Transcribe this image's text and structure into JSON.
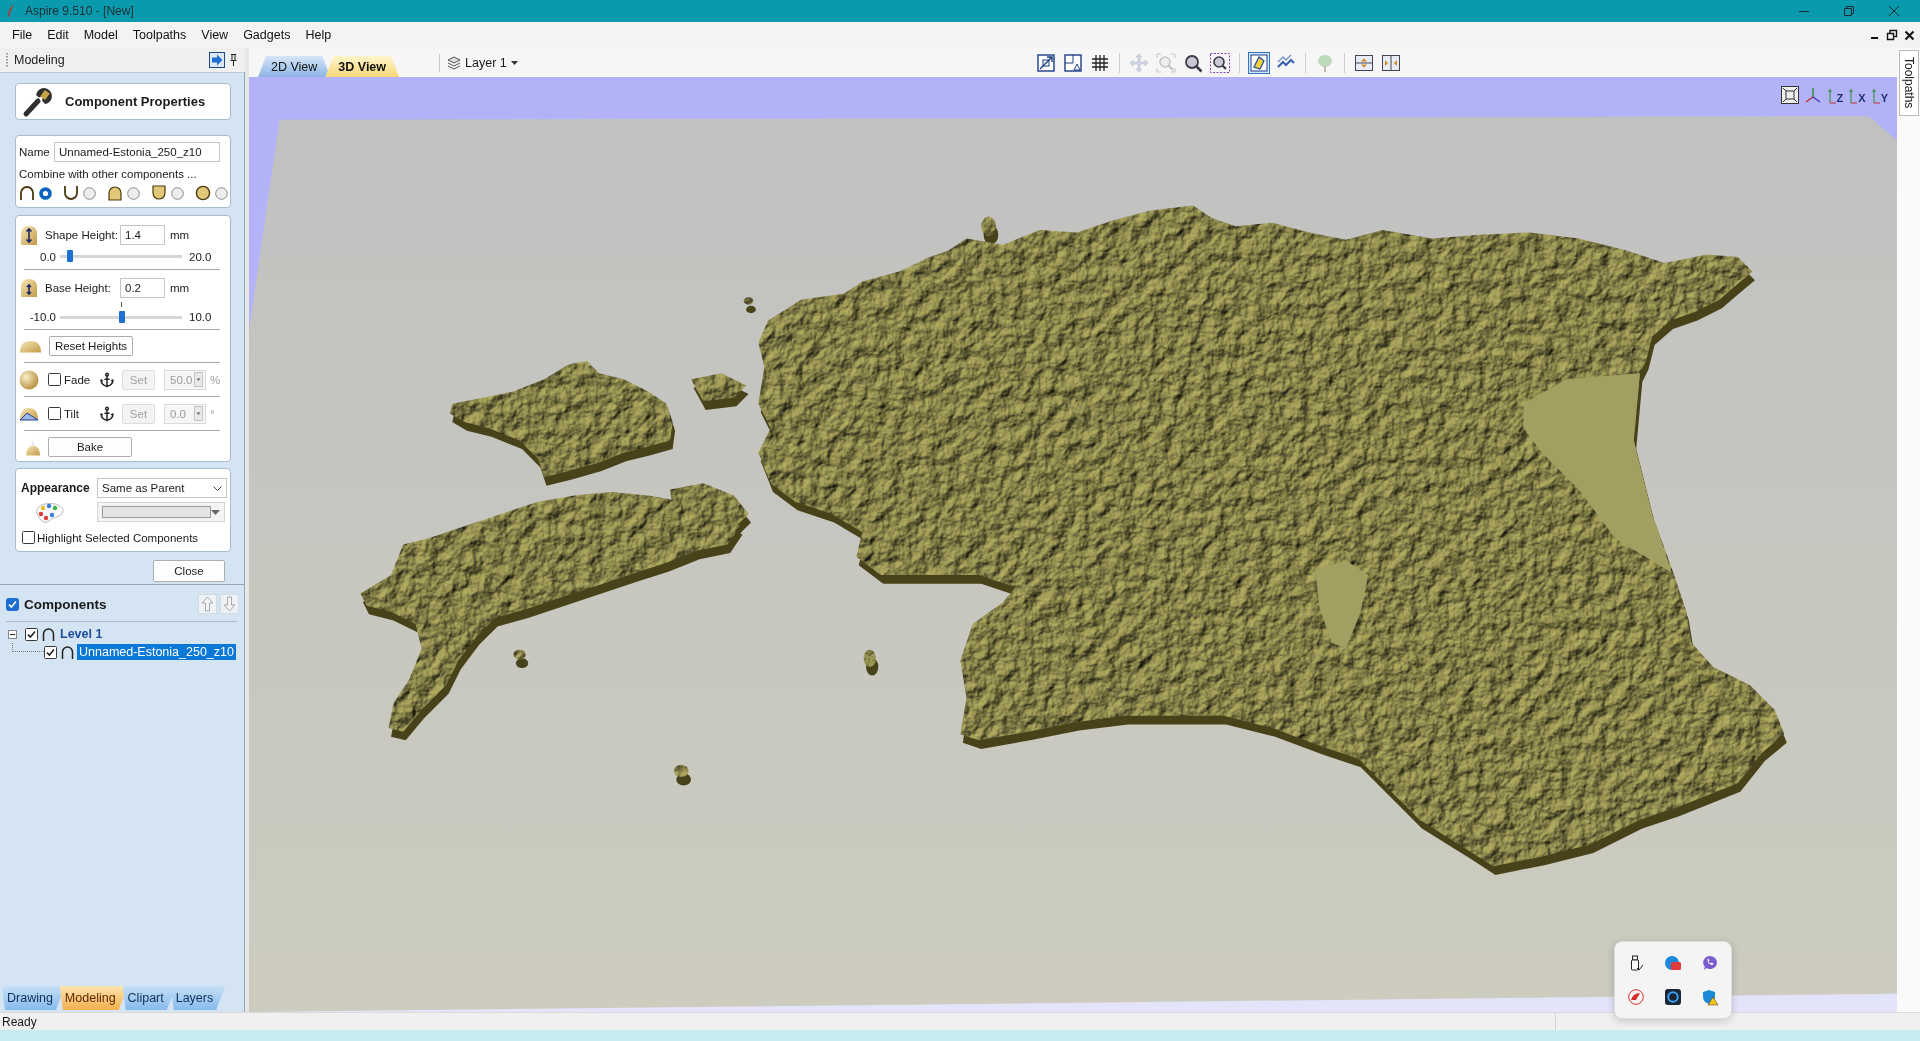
{
  "window": {
    "title": "Aspire 9.510 - [New]"
  },
  "menu": [
    "File",
    "Edit",
    "Model",
    "Toolpaths",
    "View",
    "Gadgets",
    "Help"
  ],
  "side_panel": {
    "title": "Modeling",
    "properties": {
      "title": "Component Properties",
      "name_label": "Name",
      "name_value": "Unnamed-Estonia_250_z10",
      "combine_label": "Combine with other components ...",
      "combine_modes": [
        {
          "kind": "add",
          "selected": true
        },
        {
          "kind": "subtract",
          "selected": false
        },
        {
          "kind": "merge",
          "selected": false
        },
        {
          "kind": "low",
          "selected": false
        },
        {
          "kind": "multiply",
          "selected": false
        }
      ],
      "shape_height": {
        "label": "Shape Height:",
        "value": "1.4",
        "unit": "mm",
        "min": "0.0",
        "max": "20.0",
        "level": 0.08
      },
      "base_height": {
        "label": "Base Height:",
        "value": "0.2",
        "unit": "mm",
        "min": "-10.0",
        "max": "10.0",
        "level": 0.51
      },
      "reset_button": "Reset Heights",
      "fade": {
        "label": "Fade",
        "checked": false,
        "button": "Set",
        "value": "50.0",
        "unit": "%"
      },
      "tilt": {
        "label": "Tilt",
        "checked": false,
        "button": "Set",
        "value": "0.0",
        "unit": "°"
      },
      "bake_button": "Bake",
      "appearance": {
        "label": "Appearance",
        "value": "Same as Parent"
      },
      "highlight": {
        "label": "Highlight Selected Components",
        "checked": false
      },
      "close_button": "Close"
    },
    "components": {
      "title": "Components",
      "checked": true,
      "move_buttons": [
        {
          "kind": "up",
          "disabled": true
        },
        {
          "kind": "down",
          "disabled": true
        }
      ],
      "tree": [
        {
          "label": "Level 1",
          "checked": true,
          "expanded": true,
          "selected": false,
          "children": [
            {
              "label": "Unnamed-Estonia_250_z10",
              "checked": true,
              "selected": true
            }
          ]
        }
      ]
    },
    "tabs": [
      {
        "label": "Drawing",
        "selected": false
      },
      {
        "label": "Modeling",
        "selected": true
      },
      {
        "label": "Clipart",
        "selected": false
      },
      {
        "label": "Layers",
        "selected": false
      }
    ]
  },
  "view_tabs": [
    {
      "label": "2D View",
      "selected": false
    },
    {
      "label": "3D View",
      "selected": true
    }
  ],
  "layer_selector": {
    "label": "Layer 1"
  },
  "toolbar_groups": [
    {
      "items": [
        {
          "kind": "zoom-extents",
          "disabled": false,
          "pressed": false
        },
        {
          "kind": "view-layout",
          "disabled": false,
          "pressed": false
        },
        {
          "kind": "grid",
          "disabled": false,
          "pressed": false
        }
      ]
    },
    {
      "items": [
        {
          "kind": "pan",
          "disabled": true,
          "pressed": false
        },
        {
          "kind": "zoom-frame",
          "disabled": true,
          "pressed": false
        },
        {
          "kind": "zoom",
          "disabled": false,
          "pressed": false
        },
        {
          "kind": "zoom-box",
          "disabled": false,
          "pressed": false
        }
      ]
    },
    {
      "items": [
        {
          "kind": "render",
          "disabled": false,
          "pressed": true
        },
        {
          "kind": "toolpath",
          "disabled": false,
          "pressed": false
        }
      ]
    },
    {
      "items": [
        {
          "kind": "tree",
          "disabled": true,
          "pressed": false
        }
      ]
    },
    {
      "items": [
        {
          "kind": "split-horizontal",
          "disabled": false,
          "pressed": false
        },
        {
          "kind": "split-vertical",
          "disabled": false,
          "pressed": false
        }
      ]
    }
  ],
  "view_buttons": [
    {
      "kind": "fit"
    },
    {
      "kind": "iso"
    },
    {
      "kind": "axis",
      "label": "Z"
    },
    {
      "kind": "axis",
      "label": "X"
    },
    {
      "kind": "axis",
      "label": "Y"
    }
  ],
  "right_dock": {
    "tab": "Toolpaths"
  },
  "status_bar": {
    "text": "Ready"
  },
  "tray_popup": {
    "icons": [
      {
        "kind": "usb"
      },
      {
        "kind": "badge-app"
      },
      {
        "kind": "chat"
      },
      {
        "kind": "gauge"
      },
      {
        "kind": "ring"
      },
      {
        "kind": "shield-warning"
      }
    ]
  }
}
